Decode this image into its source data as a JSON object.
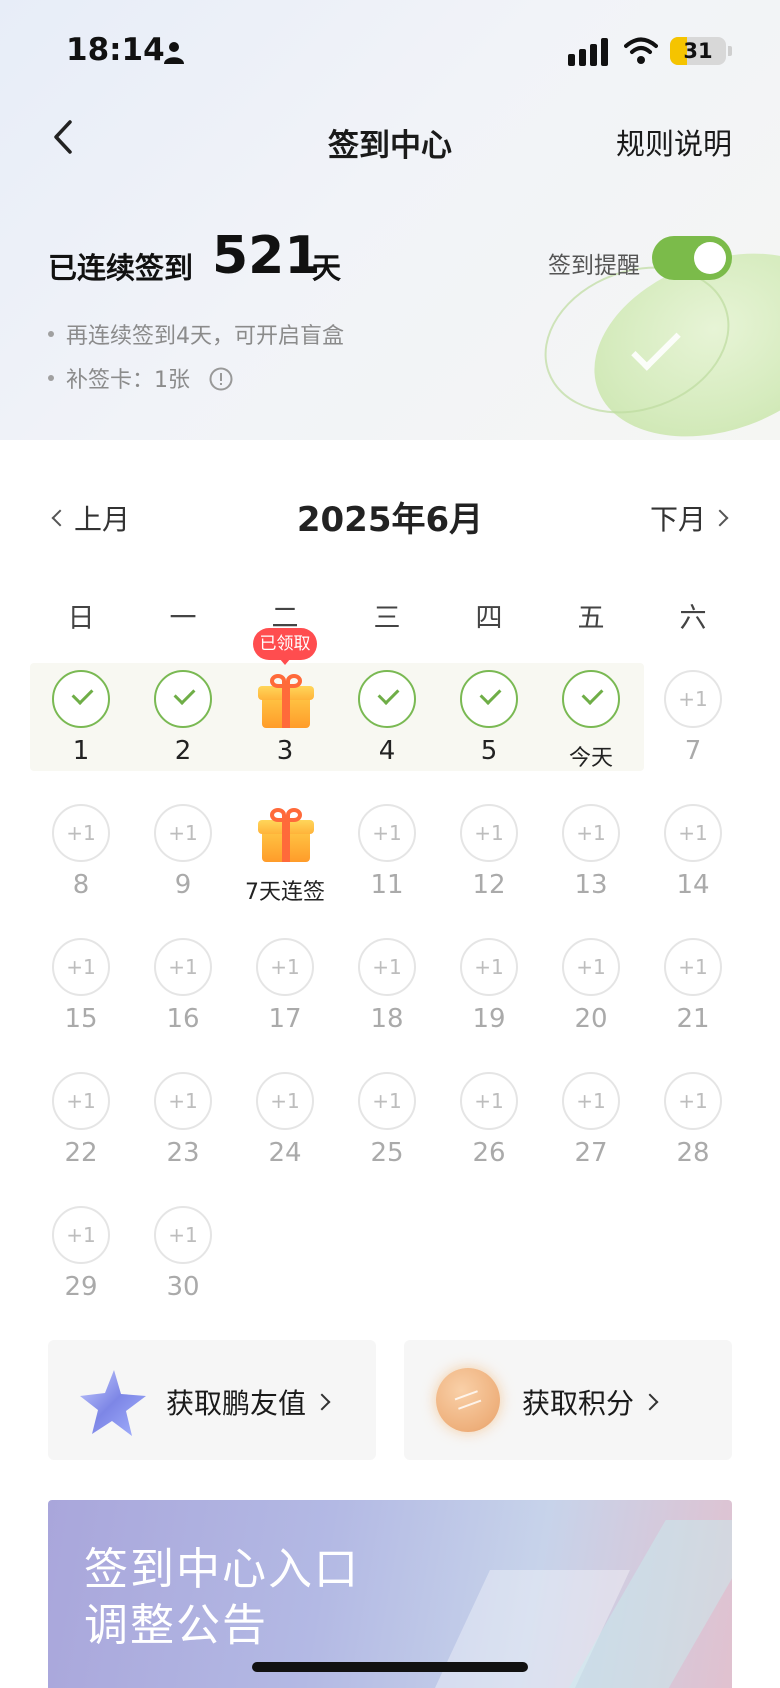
{
  "status_bar": {
    "time": "18:14",
    "battery": "31",
    "battery_level_pct": 31
  },
  "nav": {
    "title": "签到中心",
    "rules": "规则说明"
  },
  "streak": {
    "label": "已连续签到",
    "count": "521",
    "unit": "天",
    "reminder_label": "签到提醒",
    "reminder_on": true
  },
  "notes": [
    "再连续签到4天，可开启盲盒",
    "补签卡：1张"
  ],
  "calendar": {
    "prev_label": "上月",
    "title": "2025年6月",
    "next_label": "下月",
    "weekdays": [
      "日",
      "一",
      "二",
      "三",
      "四",
      "五",
      "六"
    ],
    "claimed_badge": "已领取",
    "today_label": "今天",
    "streak7_label": "7天连签",
    "plus_label": "+1",
    "days": [
      {
        "n": "1",
        "state": "done"
      },
      {
        "n": "2",
        "state": "done"
      },
      {
        "n": "3",
        "state": "gift_claimed"
      },
      {
        "n": "4",
        "state": "done"
      },
      {
        "n": "5",
        "state": "done"
      },
      {
        "n": "今天",
        "state": "done_today"
      },
      {
        "n": "7",
        "state": "plus"
      },
      {
        "n": "8",
        "state": "plus"
      },
      {
        "n": "9",
        "state": "plus"
      },
      {
        "n": "7天连签",
        "state": "gift"
      },
      {
        "n": "11",
        "state": "plus"
      },
      {
        "n": "12",
        "state": "plus"
      },
      {
        "n": "13",
        "state": "plus"
      },
      {
        "n": "14",
        "state": "plus"
      },
      {
        "n": "15",
        "state": "plus"
      },
      {
        "n": "16",
        "state": "plus"
      },
      {
        "n": "17",
        "state": "plus"
      },
      {
        "n": "18",
        "state": "plus"
      },
      {
        "n": "19",
        "state": "plus"
      },
      {
        "n": "20",
        "state": "plus"
      },
      {
        "n": "21",
        "state": "plus"
      },
      {
        "n": "22",
        "state": "plus"
      },
      {
        "n": "23",
        "state": "plus"
      },
      {
        "n": "24",
        "state": "plus"
      },
      {
        "n": "25",
        "state": "plus"
      },
      {
        "n": "26",
        "state": "plus"
      },
      {
        "n": "27",
        "state": "plus"
      },
      {
        "n": "28",
        "state": "plus"
      },
      {
        "n": "29",
        "state": "plus"
      },
      {
        "n": "30",
        "state": "plus"
      }
    ]
  },
  "actions": [
    {
      "label": "获取鹏友值",
      "icon": "star-icon"
    },
    {
      "label": "获取积分",
      "icon": "coin-icon"
    }
  ],
  "banner": {
    "line1": "签到中心入口",
    "line2": "调整公告"
  },
  "colors": {
    "accent_green": "#7bbb4a",
    "badge_red": "#ff4d4f",
    "gift_orange": "#ff9c2a"
  }
}
